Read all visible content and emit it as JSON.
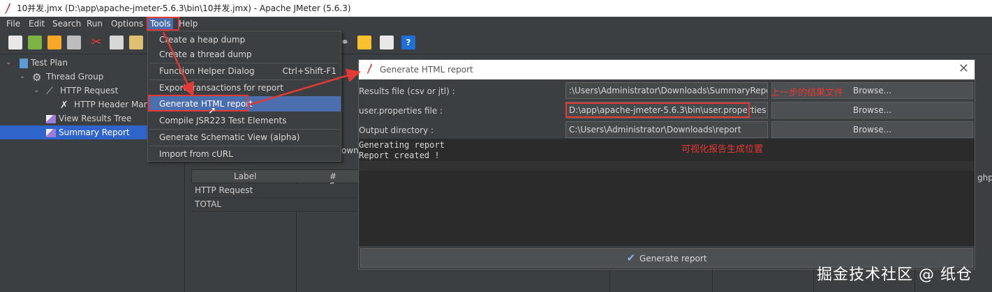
{
  "window": {
    "title": "10并发.jmx (D:\\app\\apache-jmeter-5.6.3\\bin\\10并发.jmx) - Apache JMeter (5.6.3)"
  },
  "menubar": [
    "File",
    "Edit",
    "Search",
    "Run",
    "Options",
    "Tools",
    "Help"
  ],
  "tree": {
    "items": [
      {
        "label": "Test Plan",
        "icon": "flask-icon"
      },
      {
        "label": "Thread Group",
        "icon": "gear-icon"
      },
      {
        "label": "HTTP Request",
        "icon": "pipette-icon"
      },
      {
        "label": "HTTP Header Mana",
        "icon": "wrench-icon"
      },
      {
        "label": "View Results Tree",
        "icon": "chart-icon"
      },
      {
        "label": "Summary Report",
        "icon": "chart-icon"
      }
    ],
    "selected": "Summary Report"
  },
  "tools_menu": {
    "items": [
      {
        "label": "Create a heap dump",
        "shortcut": ""
      },
      {
        "label": "Create a thread dump",
        "shortcut": ""
      },
      {
        "label": "Function Helper Dialog",
        "shortcut": "Ctrl+Shift-F1"
      },
      {
        "label": "Export transactions for report",
        "shortcut": ""
      },
      {
        "label": "Generate HTML report",
        "shortcut": ""
      },
      {
        "label": "Compile JSR223 Test Elements",
        "shortcut": ""
      },
      {
        "label": "Generate Schematic View (alpha)",
        "shortcut": ""
      },
      {
        "label": "Import from cURL",
        "shortcut": ""
      }
    ],
    "highlighted": "Generate HTML report"
  },
  "table": {
    "headers": [
      "Label",
      "# Samp"
    ],
    "rows": [
      "HTTP Request",
      "TOTAL"
    ],
    "fragment_ownlo": "ownlo",
    "fragment_ghp": "ghp"
  },
  "dialog": {
    "title": "Generate HTML report",
    "results_label": "Results file (csv or jtl) :",
    "results_value": ":\\Users\\Administrator\\Downloads\\SummaryReport.jtl",
    "props_label": "user.properties file :",
    "props_value": "D:\\app\\apache-jmeter-5.6.3\\bin\\user.properties",
    "output_label": "Output directory :",
    "output_value": "C:\\Users\\Administrator\\Downloads\\report",
    "browse_label": "Browse...",
    "console_lines": [
      "Generating report",
      "Report created !"
    ],
    "generate_label": "Generate report"
  },
  "annotations": {
    "results_note": "上一步的结果文件",
    "output_note": "可视化报告生成位置"
  },
  "watermark": "掘金技术社区 @ 纸仓",
  "colors": {
    "accent": "#4b6eaf",
    "annotation": "#e53935",
    "tree_selected": "#2f65ca"
  }
}
